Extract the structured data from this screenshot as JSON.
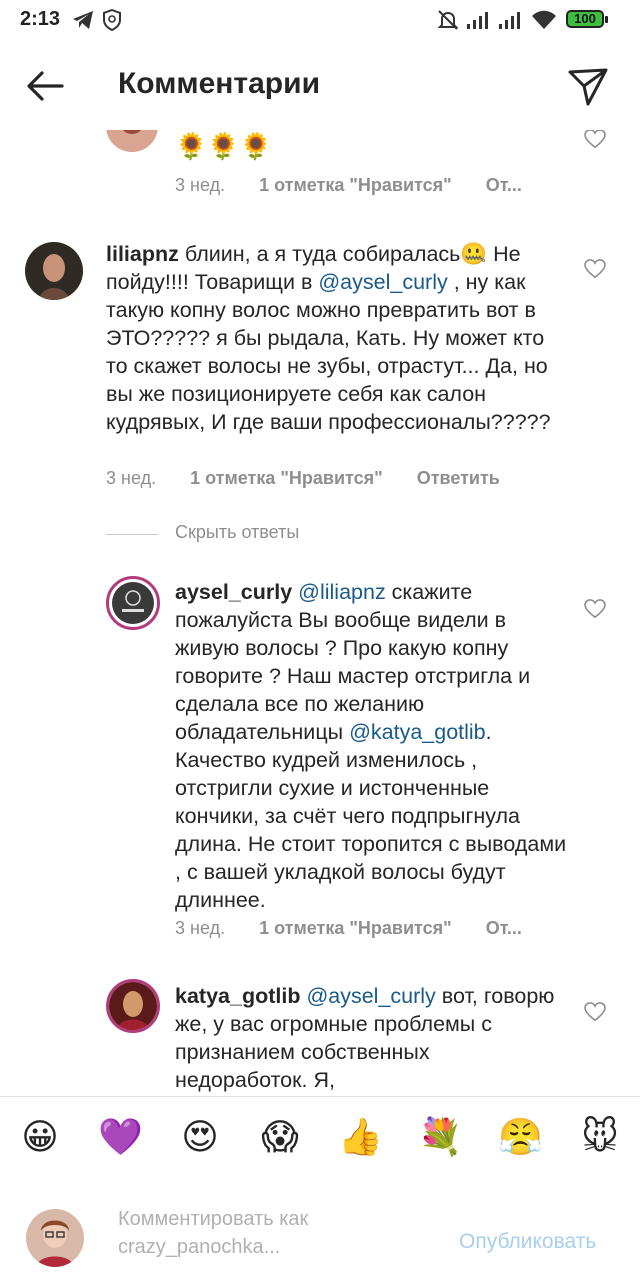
{
  "status_bar": {
    "time": "2:13",
    "battery": "100"
  },
  "header": {
    "title": "Комментарии"
  },
  "comments": [
    {
      "text_tail": "🌻🌻🌻",
      "meta": {
        "time": "3 нед.",
        "likes": "1 отметка \"Нравится\"",
        "reply": "От..."
      }
    },
    {
      "username": "liliapnz",
      "text_part1": "блиин, а я туда собиралась🤐 Не пойду!!!! Товарищи в ",
      "mention": "@aysel_curly",
      "text_part2": " , ну как такую копну волос можно превратить вот в ЭТО????? я бы рыдала, Кать.  Ну может кто то скажет волосы не зубы, отрастут... Да, но вы же позиционируете себя как салон кудрявых, И где ваши профессионалы?????",
      "meta": {
        "time": "3 нед.",
        "likes": "1 отметка \"Нравится\"",
        "reply": "Ответить"
      }
    },
    {
      "username": "aysel_curly",
      "mention": "@liliapnz",
      "text_part1": " скажите пожалуйста Вы вообще видели в живую волосы ? Про какую копну говорите ? Наш мастер отстригла и сделала все по желанию обладательницы ",
      "mention2": "@katya_gotlib",
      "text_part2": ". Качество кудрей изменилось , отстригли сухие и истонченные кончики, за счёт чего подпрыгнула длина. Не стоит торопится с выводами , с вашей укладкой волосы будут длиннее.",
      "meta": {
        "time": "3 нед.",
        "likes": "1 отметка \"Нравится\"",
        "reply": "От..."
      }
    },
    {
      "username": "katya_gotlib",
      "mention": "@aysel_curly",
      "text_part1": " вот, говорю же, у вас огромные проблемы с признанием собственных недоработок. Я,"
    }
  ],
  "hide_replies": "Скрыть ответы",
  "emoji_bar": [
    "😀",
    "💜",
    "😍",
    "😱",
    "👍",
    "💐",
    "😤",
    "🐭"
  ],
  "input": {
    "placeholder": "Комментировать как crazy_panochka...",
    "publish": "Опубликовать"
  }
}
